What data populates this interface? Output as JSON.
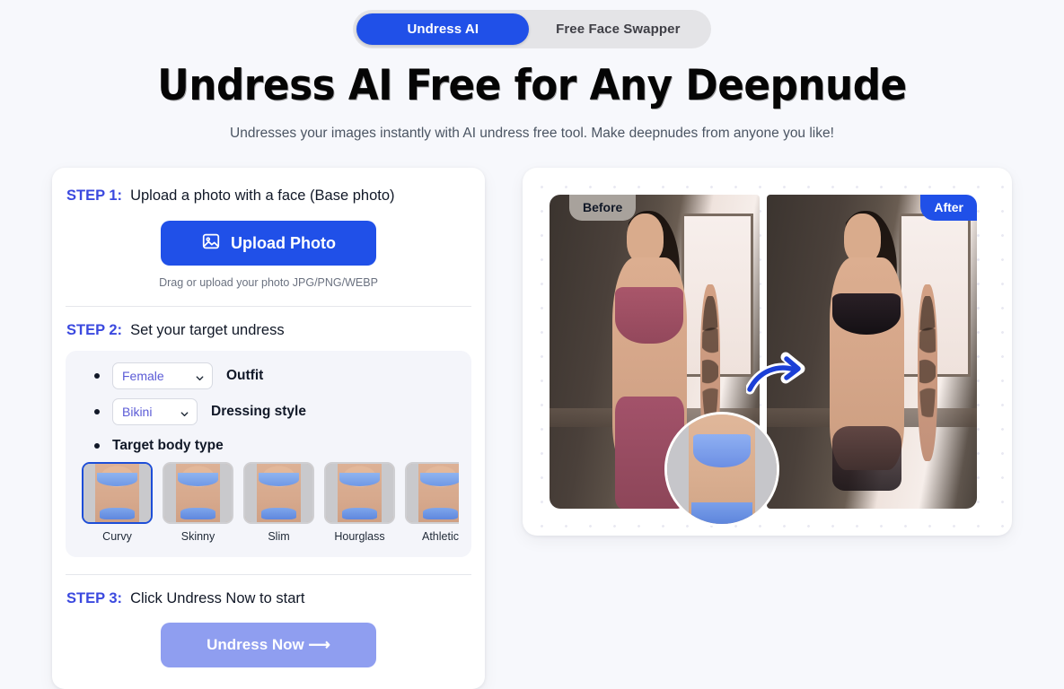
{
  "tabs": [
    {
      "label": "Undress AI",
      "active": true
    },
    {
      "label": "Free Face Swapper",
      "active": false
    }
  ],
  "hero": {
    "title": "Undress AI Free for Any Deepnude",
    "subtitle": "Undresses your images instantly with AI undress free tool. Make deepnudes from anyone you like!"
  },
  "steps": {
    "step1": {
      "tag": "STEP 1:",
      "text": "Upload a photo with a face (Base photo)",
      "upload_button": "Upload Photo",
      "upload_icon": "image-icon",
      "hint": "Drag or upload your photo JPG/PNG/WEBP"
    },
    "step2": {
      "tag": "STEP 2:",
      "text": "Set your target undress",
      "outfit": {
        "value": "Female",
        "label": "Outfit",
        "chevron": "chevron-down-icon"
      },
      "dressing_style": {
        "value": "Bikini",
        "label": "Dressing style",
        "chevron": "chevron-down-icon"
      },
      "body_type_label": "Target body type",
      "body_types": [
        {
          "label": "Curvy",
          "selected": true
        },
        {
          "label": "Skinny",
          "selected": false
        },
        {
          "label": "Slim",
          "selected": false
        },
        {
          "label": "Hourglass",
          "selected": false
        },
        {
          "label": "Athletic",
          "selected": false
        }
      ]
    },
    "step3": {
      "tag": "STEP 3:",
      "text": "Click Undress Now to start",
      "cta": "Undress Now ⟶"
    }
  },
  "preview": {
    "before_badge": "Before",
    "after_badge": "After",
    "arrow_icon": "curved-arrow-icon",
    "inset_icon": "zoom-inset-circle"
  },
  "colors": {
    "accent_blue": "#2050e8",
    "step_tag_blue": "#3b49df",
    "select_text": "#5b5bd6",
    "cta_muted": "#8f9ef0",
    "page_bg": "#f7f8fc",
    "tabbar_bg": "#e4e4e7",
    "before_badge_bg": "#a8a29c",
    "selected_thumb_border": "#1d4ed8"
  }
}
